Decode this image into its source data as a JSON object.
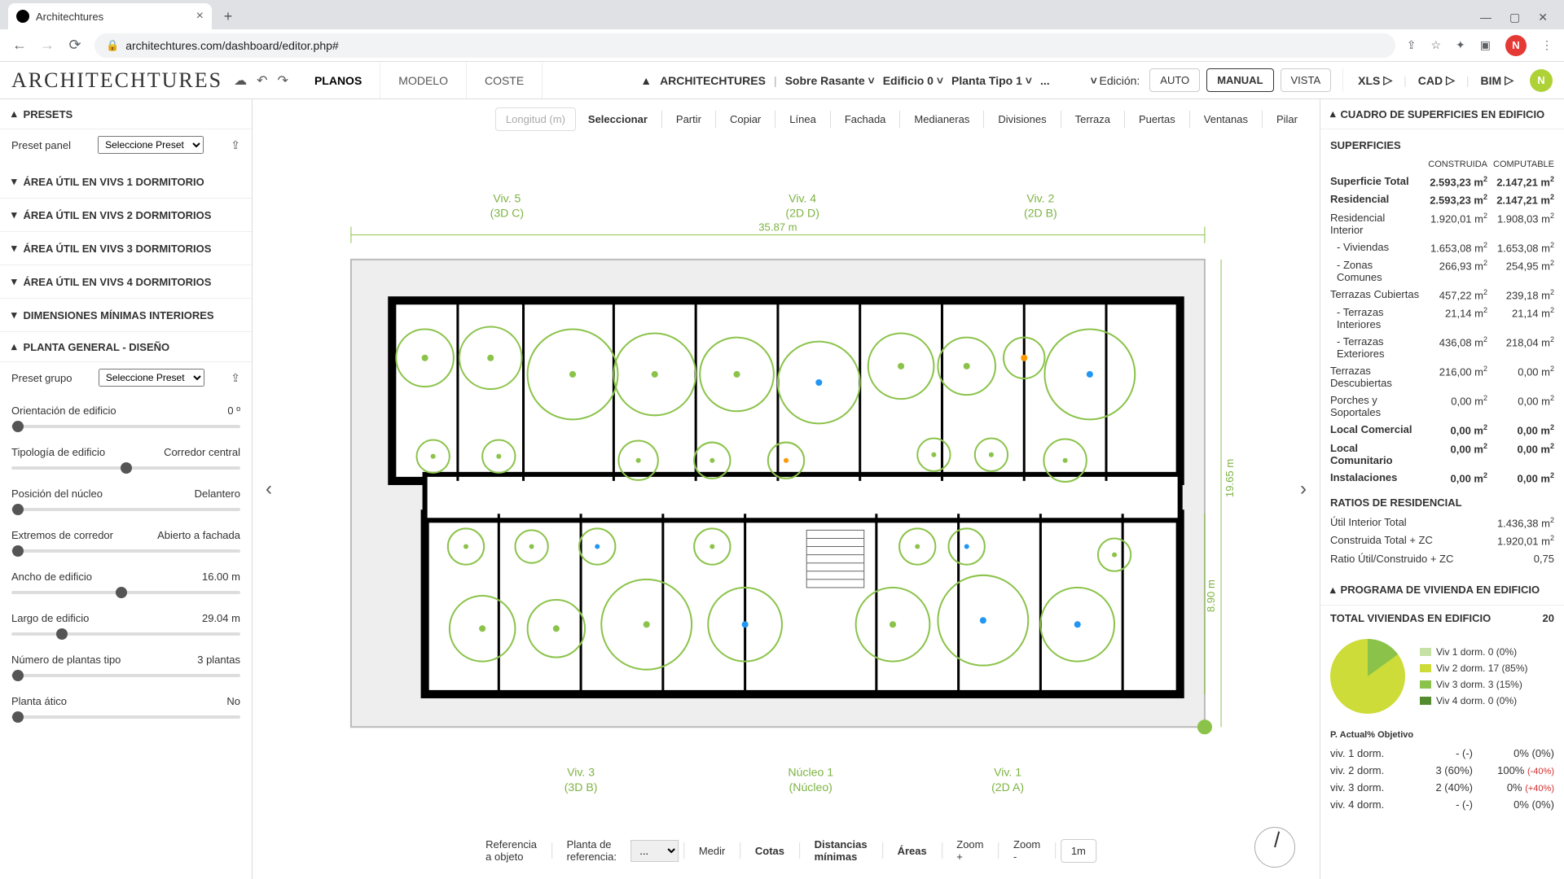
{
  "browser": {
    "tab_title": "Architechtures",
    "url": "architechtures.com/dashboard/editor.php#",
    "avatar_letter": "N"
  },
  "header": {
    "logo": "ARCHITECHTURES",
    "tabs": {
      "planos": "PLANOS",
      "modelo": "MODELO",
      "coste": "COSTE"
    },
    "breadcrumb": {
      "root": "ARCHITECHTURES",
      "lvl1": "Sobre Rasante",
      "lvl2": "Edificio 0",
      "lvl3": "Planta Tipo 1",
      "lvl4": "..."
    },
    "edition_label": "Edición:",
    "mode": {
      "auto": "AUTO",
      "manual": "MANUAL",
      "vista": "VISTA"
    },
    "export": {
      "xls": "XLS",
      "cad": "CAD",
      "bim": "BIM"
    },
    "avatar_letter": "N"
  },
  "left": {
    "presets_title": "PRESETS",
    "preset_panel_label": "Preset panel",
    "preset_select_placeholder": "Seleccione Preset",
    "sections": {
      "a1": "ÁREA ÚTIL EN VIVS 1 DORMITORIO",
      "a2": "ÁREA ÚTIL EN VIVS 2 DORMITORIOS",
      "a3": "ÁREA ÚTIL EN VIVS 3 DORMITORIOS",
      "a4": "ÁREA ÚTIL EN VIVS 4 DORMITORIOS",
      "dim": "DIMENSIONES MÍNIMAS INTERIORES",
      "planta": "PLANTA GENERAL - DISEÑO"
    },
    "preset_grupo_label": "Preset grupo",
    "sliders": {
      "orientacion": {
        "label": "Orientación de edificio",
        "value": "0",
        "unit": "º"
      },
      "tipologia": {
        "label": "Tipología de edificio",
        "value": "Corredor central"
      },
      "nucleo": {
        "label": "Posición del núcleo",
        "value": "Delantero"
      },
      "extremos": {
        "label": "Extremos de corredor",
        "value": "Abierto a fachada"
      },
      "ancho": {
        "label": "Ancho de edificio",
        "value": "16.00",
        "unit": "m"
      },
      "largo": {
        "label": "Largo de edificio",
        "value": "29.04",
        "unit": "m"
      },
      "plantas": {
        "label": "Número de plantas tipo",
        "value": "3",
        "unit": "plantas"
      },
      "atico": {
        "label": "Planta ático",
        "value": "No"
      }
    }
  },
  "canvas": {
    "top_tools": {
      "longitud": "Longitud (m)",
      "seleccionar": "Seleccionar",
      "partir": "Partir",
      "copiar": "Copiar",
      "linea": "Línea",
      "fachada": "Fachada",
      "medianeras": "Medianeras",
      "divisiones": "Divisiones",
      "terraza": "Terraza",
      "puertas": "Puertas",
      "ventanas": "Ventanas",
      "pilar": "Pilar"
    },
    "units": {
      "viv5_a": "Viv. 5",
      "viv5_b": "(3D C)",
      "viv4_a": "Viv. 4",
      "viv4_b": "(2D D)",
      "viv2_a": "Viv. 2",
      "viv2_b": "(2D B)",
      "viv3_a": "Viv. 3",
      "viv3_b": "(3D B)",
      "nucleo_a": "Núcleo 1",
      "nucleo_b": "(Núcleo)",
      "viv1_a": "Viv. 1",
      "viv1_b": "(2D A)"
    },
    "dims": {
      "width": "35.87 m",
      "h1": "19.65 m",
      "h2": "8.90 m"
    },
    "bottom_tools": {
      "ref_obj": "Referencia a objeto",
      "planta_ref": "Planta de referencia:",
      "planta_ref_val": "...",
      "medir": "Medir",
      "cotas": "Cotas",
      "dist_min": "Distancias mínimas",
      "areas": "Áreas",
      "zoom_in": "Zoom +",
      "zoom_out": "Zoom -",
      "scale": "1m"
    }
  },
  "right": {
    "panel1_title": "CUADRO DE SUPERFICIES EN EDIFICIO",
    "superficies_title": "SUPERFICIES",
    "col1": "CONSTRUIDA",
    "col2": "COMPUTABLE",
    "rows": [
      {
        "lab": "Superficie Total",
        "c1": "2.593,23 m²",
        "c2": "2.147,21 m²",
        "bold": true
      },
      {
        "lab": "Residencial",
        "c1": "2.593,23 m²",
        "c2": "2.147,21 m²",
        "bold": true
      },
      {
        "lab": "Residencial Interior",
        "c1": "1.920,01 m²",
        "c2": "1.908,03 m²"
      },
      {
        "lab": "- Viviendas",
        "c1": "1.653,08 m²",
        "c2": "1.653,08 m²",
        "indent": true
      },
      {
        "lab": "- Zonas Comunes",
        "c1": "266,93 m²",
        "c2": "254,95 m²",
        "indent": true
      },
      {
        "lab": "Terrazas Cubiertas",
        "c1": "457,22 m²",
        "c2": "239,18 m²"
      },
      {
        "lab": "- Terrazas Interiores",
        "c1": "21,14 m²",
        "c2": "21,14 m²",
        "indent": true
      },
      {
        "lab": "- Terrazas Exteriores",
        "c1": "436,08 m²",
        "c2": "218,04 m²",
        "indent": true
      },
      {
        "lab": "Terrazas Descubiertas",
        "c1": "216,00 m²",
        "c2": "0,00 m²"
      },
      {
        "lab": "Porches y Soportales",
        "c1": "0,00 m²",
        "c2": "0,00 m²"
      },
      {
        "lab": "Local Comercial",
        "c1": "0,00 m²",
        "c2": "0,00 m²",
        "bold": true
      },
      {
        "lab": "Local Comunitario",
        "c1": "0,00 m²",
        "c2": "0,00 m²",
        "bold": true
      },
      {
        "lab": "Instalaciones",
        "c1": "0,00 m²",
        "c2": "0,00 m²",
        "bold": true
      }
    ],
    "ratios_title": "RATIOS DE RESIDENCIAL",
    "ratios": [
      {
        "lab": "Útil Interior Total",
        "val": "1.436,38 m²"
      },
      {
        "lab": "Construida Total + ZC",
        "val": "1.920,01 m²"
      },
      {
        "lab": "Ratio Útil/Construido + ZC",
        "val": "0,75"
      }
    ],
    "panel2_title": "PROGRAMA DE VIVIENDA EN EDIFICIO",
    "total_viv_label": "TOTAL VIVIENDAS EN EDIFICIO",
    "total_viv_value": "20",
    "legend": [
      {
        "color": "#c5e1a5",
        "text": "Viv 1 dorm. 0 (0%)"
      },
      {
        "color": "#cddc39",
        "text": "Viv 2 dorm. 17 (85%)"
      },
      {
        "color": "#8bc34a",
        "text": "Viv 3 dorm. 3 (15%)"
      },
      {
        "color": "#558b2f",
        "text": "Viv 4 dorm. 0 (0%)"
      }
    ],
    "prog_head": {
      "c2": "P. Actual",
      "c3": "% Objetivo"
    },
    "prog_rows": [
      {
        "lab": "viv. 1 dorm.",
        "actual": "- (-)",
        "obj": "0%",
        "delta": "(0%)",
        "dc": ""
      },
      {
        "lab": "viv. 2 dorm.",
        "actual": "3 (60%)",
        "obj": "100%",
        "delta": "(-40%)",
        "dc": "deltaR"
      },
      {
        "lab": "viv. 3 dorm.",
        "actual": "2 (40%)",
        "obj": "0%",
        "delta": "(+40%)",
        "dc": "deltaR"
      },
      {
        "lab": "viv. 4 dorm.",
        "actual": "- (-)",
        "obj": "0%",
        "delta": "(0%)",
        "dc": ""
      }
    ]
  },
  "chart_data": {
    "type": "pie",
    "title": "Total viviendas en edificio",
    "categories": [
      "Viv 1 dorm.",
      "Viv 2 dorm.",
      "Viv 3 dorm.",
      "Viv 4 dorm."
    ],
    "values": [
      0,
      17,
      3,
      0
    ],
    "percentages": [
      0,
      85,
      15,
      0
    ],
    "colors": [
      "#c5e1a5",
      "#cddc39",
      "#8bc34a",
      "#558b2f"
    ]
  }
}
